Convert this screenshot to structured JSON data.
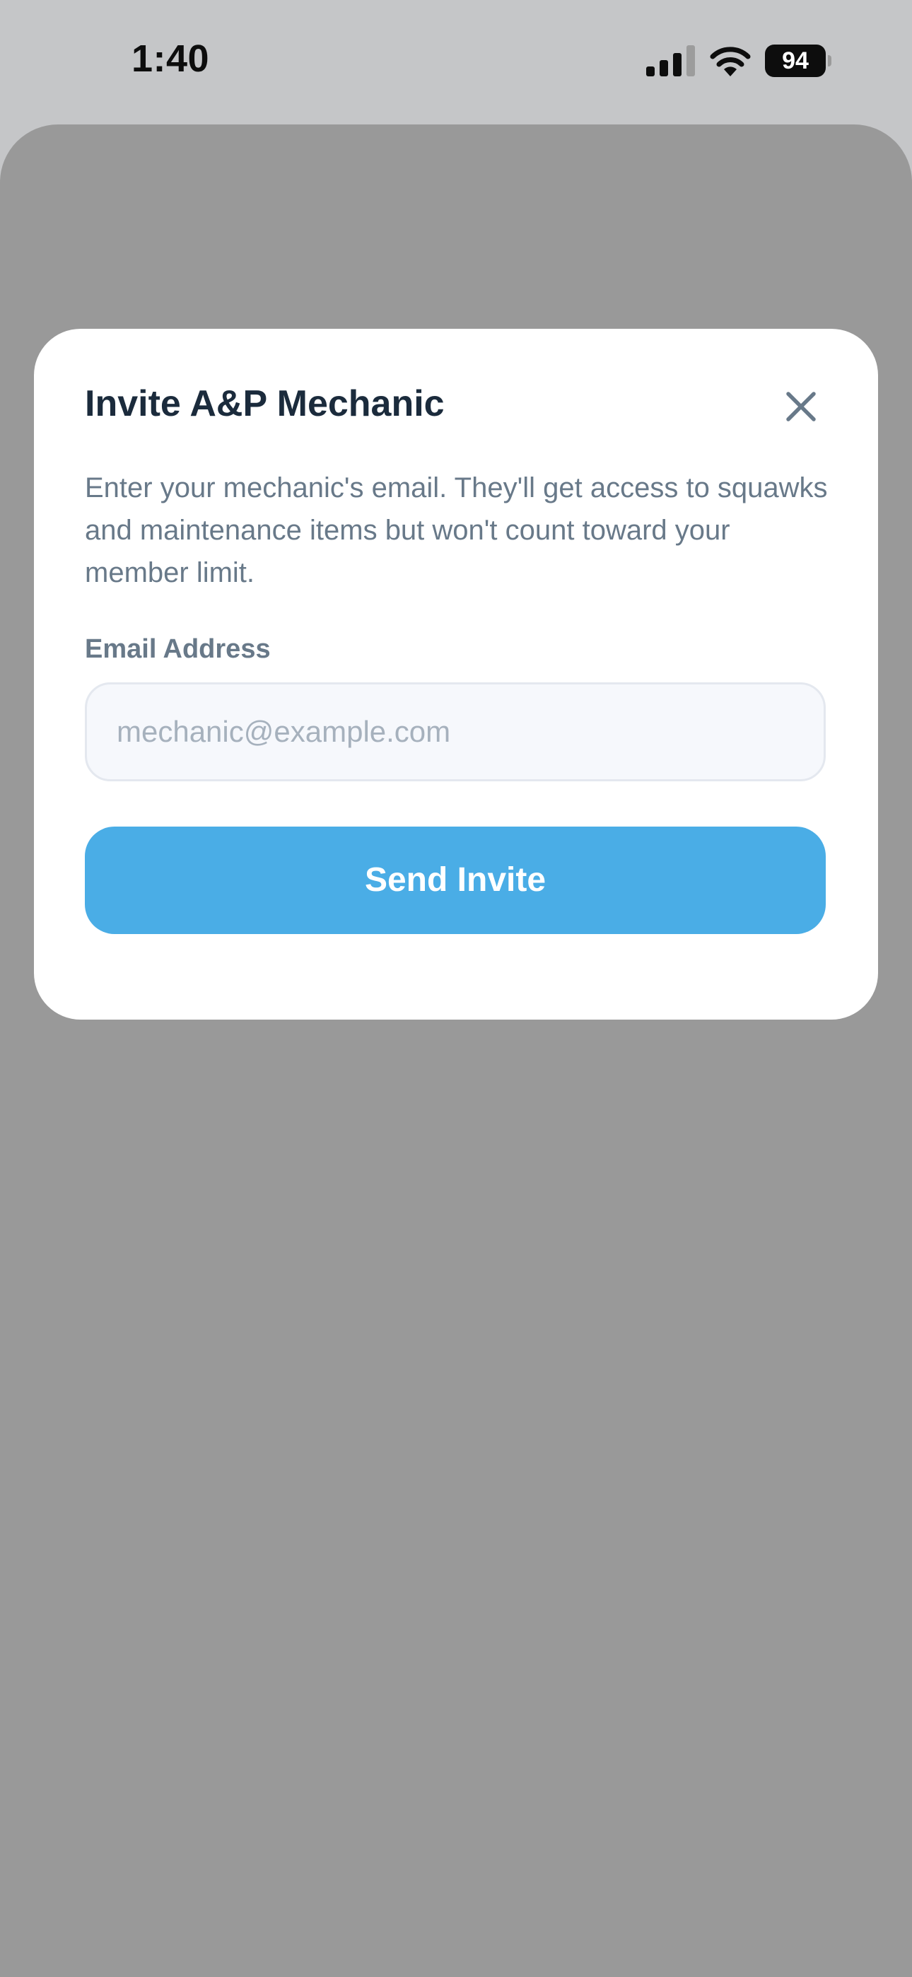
{
  "status_bar": {
    "time": "1:40",
    "battery_level": "94",
    "signal_icon": "cellular-signal-icon",
    "wifi_icon": "wifi-icon",
    "battery_icon": "battery-icon"
  },
  "modal": {
    "title": "Invite A&P Mechanic",
    "close_icon": "close-icon",
    "description": "Enter your mechanic's email. They'll get access to squawks and maintenance items but won't count toward your member limit.",
    "email_label": "Email Address",
    "email_value": "",
    "email_placeholder": "mechanic@example.com",
    "send_label": "Send Invite"
  },
  "colors": {
    "accent": "#4aade6",
    "title_text": "#1b2b3c",
    "secondary_text": "#687989",
    "backdrop": "#999999"
  }
}
